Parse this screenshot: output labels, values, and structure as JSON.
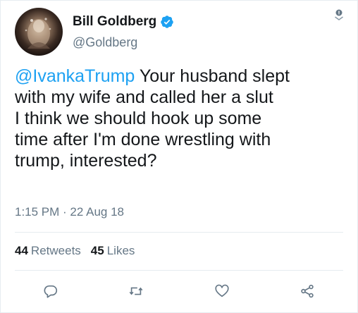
{
  "user": {
    "display_name": "Bill Goldberg",
    "handle": "@Goldberg",
    "verified_icon": "verified-badge-icon"
  },
  "tweet": {
    "mention": "@IvankaTrump",
    "text": " Your husband slept\nwith my wife and called her a slut\nI think we should hook up some\ntime after I'm done wrestling with\ntrump, interested?",
    "timestamp": "1:15 PM · 22 Aug 18"
  },
  "stats": {
    "retweets_count": "44",
    "retweets_label": "Retweets",
    "likes_count": "45",
    "likes_label": "Likes"
  },
  "actions": [
    "reply-icon",
    "retweet-icon",
    "like-icon",
    "share-icon"
  ],
  "colors": {
    "accent": "#1da1f2",
    "text": "#14171a",
    "secondary": "#657786",
    "divider": "#e6ecf0"
  }
}
